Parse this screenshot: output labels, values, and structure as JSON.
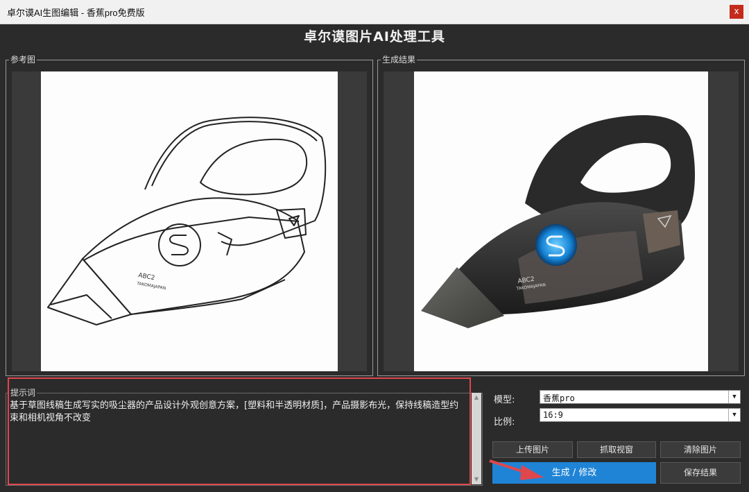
{
  "window": {
    "title": "卓尔谟AI生图编辑 - 香蕉pro免费版",
    "close_label": "x"
  },
  "app_title": "卓尔谟图片AI处理工具",
  "reference": {
    "label": "参考图"
  },
  "result": {
    "label": "生成结果"
  },
  "prompt": {
    "label": "提示词",
    "text": "基于草图线稿生成写实的吸尘器的产品设计外观创意方案，[塑料和半透明材质]，产品摄影布光，保持线稿造型约束和相机视角不改变"
  },
  "settings": {
    "model_label": "模型:",
    "model_value": "香蕉pro",
    "ratio_label": "比例:",
    "ratio_value": "16:9"
  },
  "buttons": {
    "upload": "上传图片",
    "capture": "抓取视窗",
    "clear": "清除图片",
    "generate": "生成 / 修改",
    "save": "保存结果"
  },
  "colors": {
    "accent": "#1f84d6",
    "highlight": "#e0474c",
    "background": "#2b2b2b"
  },
  "images": {
    "sketch_product_text": [
      "ABC2",
      "TAKOMAJAPAN"
    ],
    "render_product_text": [
      "ABC2",
      "TAKOMAJAPAN"
    ]
  }
}
